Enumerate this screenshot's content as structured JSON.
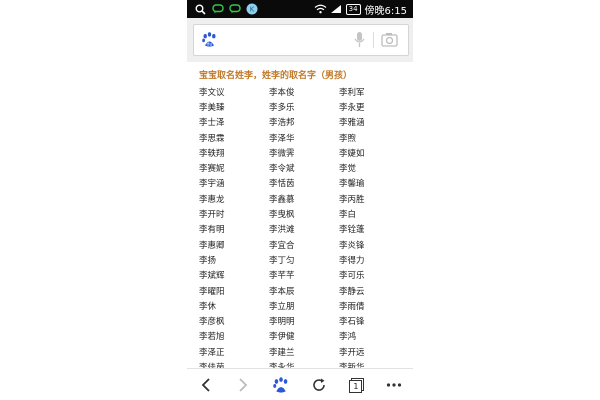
{
  "status_bar": {
    "icons": [
      "search-icon",
      "chat-icon",
      "message-icon",
      "app-icon",
      "wifi-icon",
      "signal-icon"
    ],
    "battery": "34",
    "time": "傍晚6:15"
  },
  "search": {
    "logo": "baidu-paw-icon",
    "mic": "microphone-icon",
    "camera": "camera-icon"
  },
  "content": {
    "title": "宝宝取名姓李，姓李的取名字（男孩）",
    "rows": [
      [
        "李文议",
        "李本俊",
        "李利军"
      ],
      [
        "李美臻",
        "李多乐",
        "李永更"
      ],
      [
        "李士泽",
        "李浩邦",
        "李雅涵"
      ],
      [
        "李思霖",
        "李泽华",
        "李煦"
      ],
      [
        "李轶翔",
        "李微霁",
        "李婕如"
      ],
      [
        "李赛妮",
        "李令斌",
        "李觉"
      ],
      [
        "李宇涵",
        "李恬茵",
        "李馨瑜"
      ],
      [
        "李惠龙",
        "李鑫慕",
        "李丙胜"
      ],
      [
        "李开时",
        "李曳枫",
        "李白"
      ],
      [
        "李有明",
        "李洪滩",
        "李铨蓬"
      ],
      [
        "李惠卿",
        "李宜合",
        "李炎锋"
      ],
      [
        "李扬",
        "李丁匀",
        "李得力"
      ],
      [
        "李斌辉",
        "李芊芊",
        "李可乐"
      ],
      [
        "李曜阳",
        "李本辰",
        "李静云"
      ],
      [
        "李休",
        "李立朋",
        "李雨倩"
      ],
      [
        "李彦枫",
        "李明明",
        "李石锋"
      ],
      [
        "李若旭",
        "李伊健",
        "李鸿"
      ],
      [
        "李泽正",
        "李建兰",
        "李开远"
      ],
      [
        "李佳茵",
        "李永华",
        "李新华"
      ],
      [
        "李卿辰",
        "李佳铱",
        "李鹏徽"
      ]
    ]
  },
  "toolbar": {
    "items": [
      "back-icon",
      "forward-icon",
      "baidu-paw-icon",
      "refresh-icon",
      "tabs-icon",
      "more-icon"
    ],
    "tab_count": "1"
  }
}
